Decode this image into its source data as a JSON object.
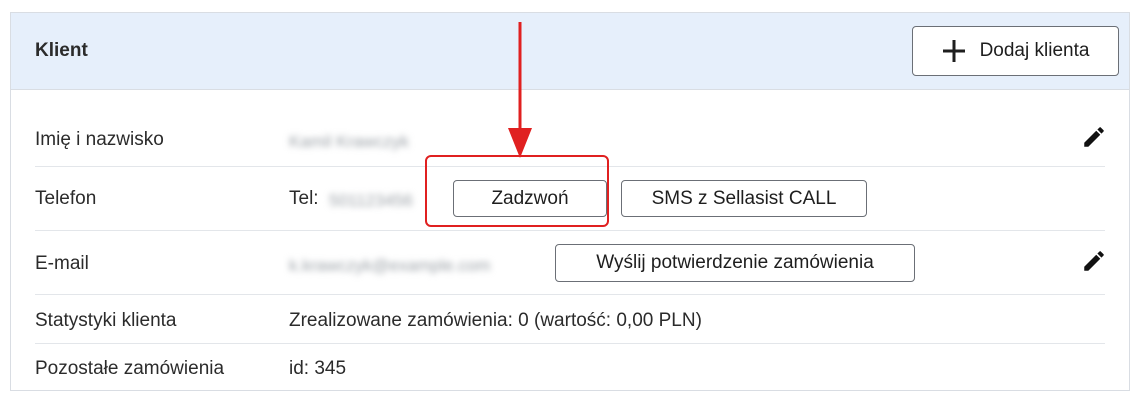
{
  "header": {
    "title": "Klient",
    "add_button_label": "Dodaj klienta",
    "add_icon": "plus-icon"
  },
  "rows": {
    "name": {
      "label": "Imię i nazwisko",
      "value": "Kamil Krawczyk",
      "edit_icon": "pencil-icon"
    },
    "phone": {
      "label": "Telefon",
      "prefix": "Tel:",
      "value": "501123456",
      "call_button": "Zadzwoń",
      "sms_button": "SMS z Sellasist CALL"
    },
    "email": {
      "label": "E-mail",
      "value": "k.krawczyk@example.com",
      "confirm_button": "Wyślij potwierdzenie zamówienia",
      "edit_icon": "pencil-icon"
    },
    "stats": {
      "label": "Statystyki klienta",
      "value": "Zrealizowane zamówienia: 0 (wartość: 0,00 PLN)"
    },
    "other_orders": {
      "label": "Pozostałe zamówienia",
      "value": "id: 345"
    }
  },
  "colors": {
    "header_bg": "#e6effb",
    "annotation_red": "#e02020",
    "border": "#d9dde3"
  }
}
